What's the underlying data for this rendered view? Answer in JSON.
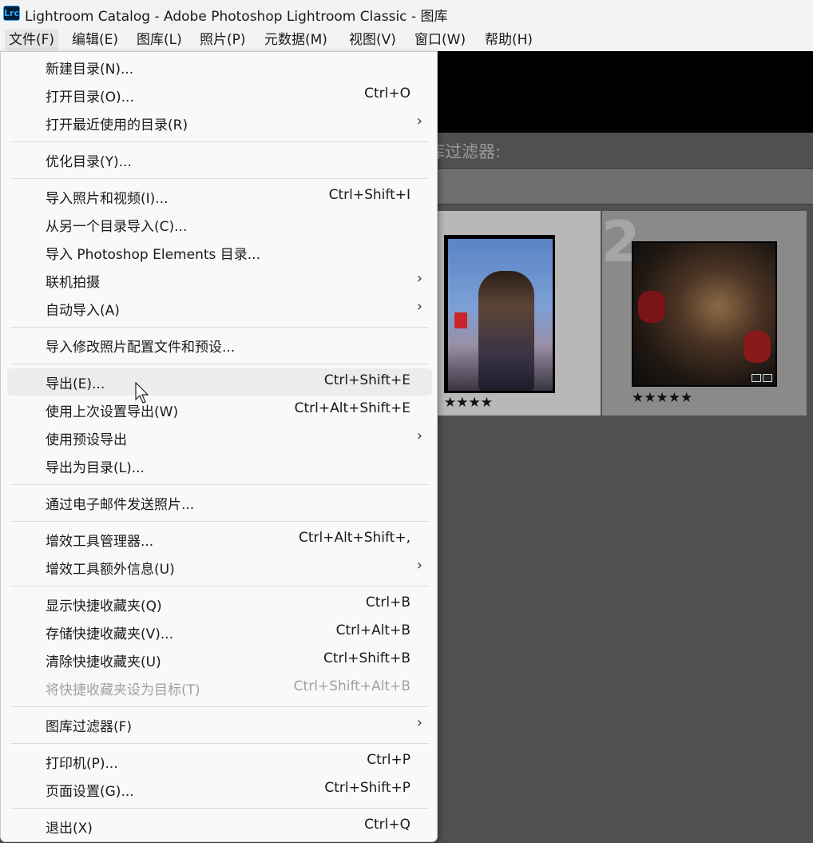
{
  "window": {
    "app_icon": "Lrc",
    "title": "Lightroom Catalog - Adobe Photoshop Lightroom Classic - 图库"
  },
  "menubar": [
    {
      "label": "文件(F)"
    },
    {
      "label": "编辑(E)"
    },
    {
      "label": "图库(L)"
    },
    {
      "label": "照片(P)"
    },
    {
      "label": "元数据(M)"
    },
    {
      "label": "视图(V)"
    },
    {
      "label": "窗口(W)"
    },
    {
      "label": "帮助(H)"
    }
  ],
  "file_menu": {
    "items": [
      {
        "label": "新建目录(N)...",
        "shortcut": ""
      },
      {
        "label": "打开目录(O)...",
        "shortcut": "Ctrl+O"
      },
      {
        "label": "打开最近使用的目录(R)",
        "shortcut": ""
      },
      {
        "label": "优化目录(Y)...",
        "shortcut": ""
      },
      {
        "label": "导入照片和视频(I)...",
        "shortcut": "Ctrl+Shift+I"
      },
      {
        "label": "从另一个目录导入(C)...",
        "shortcut": ""
      },
      {
        "label": "导入 Photoshop Elements 目录...",
        "shortcut": ""
      },
      {
        "label": "联机拍摄",
        "shortcut": ""
      },
      {
        "label": "自动导入(A)",
        "shortcut": ""
      },
      {
        "label": "导入修改照片配置文件和预设...",
        "shortcut": ""
      },
      {
        "label": "导出(E)...",
        "shortcut": "Ctrl+Shift+E"
      },
      {
        "label": "使用上次设置导出(W)",
        "shortcut": "Ctrl+Alt+Shift+E"
      },
      {
        "label": "使用预设导出",
        "shortcut": ""
      },
      {
        "label": "导出为目录(L)...",
        "shortcut": ""
      },
      {
        "label": "通过电子邮件发送照片...",
        "shortcut": ""
      },
      {
        "label": "增效工具管理器...",
        "shortcut": "Ctrl+Alt+Shift+,"
      },
      {
        "label": "增效工具额外信息(U)",
        "shortcut": ""
      },
      {
        "label": "显示快捷收藏夹(Q)",
        "shortcut": "Ctrl+B"
      },
      {
        "label": "存储快捷收藏夹(V)...",
        "shortcut": "Ctrl+Alt+B"
      },
      {
        "label": "清除快捷收藏夹(U)",
        "shortcut": "Ctrl+Shift+B"
      },
      {
        "label": "将快捷收藏夹设为目标(T)",
        "shortcut": "Ctrl+Shift+Alt+B"
      },
      {
        "label": "图库过滤器(F)",
        "shortcut": ""
      },
      {
        "label": "打印机(P)...",
        "shortcut": "Ctrl+P"
      },
      {
        "label": "页面设置(G)...",
        "shortcut": "Ctrl+Shift+P"
      },
      {
        "label": "退出(X)",
        "shortcut": "Ctrl+Q"
      }
    ],
    "submenu_arrow": "›"
  },
  "library": {
    "filter_label": "库过滤器:",
    "grid_cell_number": "2",
    "photo1_rating": "★★★★",
    "photo2_rating": "★★★★★"
  },
  "colors": {
    "menu_bg": "#f9f9f9",
    "hover_bg": "#ececec",
    "lr_panel": "#505050",
    "selected_cell": "#b8b8b8"
  }
}
